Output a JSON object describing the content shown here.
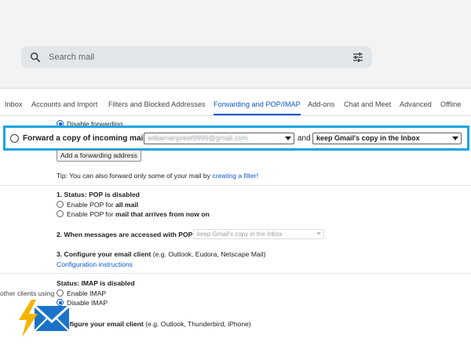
{
  "search": {
    "placeholder": "Search mail"
  },
  "tabs": [
    {
      "label": "Inbox",
      "active": false
    },
    {
      "label": "Accounts and Import",
      "active": false
    },
    {
      "label": "Filters and Blocked Addresses",
      "active": false
    },
    {
      "label": "Forwarding and POP/IMAP",
      "active": true
    },
    {
      "label": "Add-ons",
      "active": false
    },
    {
      "label": "Chat and Meet",
      "active": false
    },
    {
      "label": "Advanced",
      "active": false
    },
    {
      "label": "Offline",
      "active": false
    }
  ],
  "forwarding": {
    "disable_label": "Disable forwarding",
    "forward_label": "Forward a copy of incoming mail to",
    "email_value": "williamanpreet9999@gmail.com",
    "and_label": "and",
    "action_value": "keep Gmail's copy in the Inbox",
    "add_button": "Add a forwarding address",
    "tip_prefix": "Tip: You can also forward only some of your mail by",
    "tip_link": "creating a filter!"
  },
  "pop": {
    "status_heading": "1. Status: POP is disabled",
    "enable_all_prefix": "Enable POP for",
    "enable_all_bold": "all mail",
    "enable_now_prefix": "Enable POP for",
    "enable_now_bold": "mail that arrives from now on",
    "accessed_heading": "2. When messages are accessed with POP",
    "accessed_value": "keep Gmail's copy in the Inbox",
    "configure_heading": "3. Configure your email client",
    "configure_hint": "(e.g. Outlook, Eudora, Netscape Mail)",
    "configure_link": "Configuration instructions"
  },
  "imap": {
    "side_label": "other clients using",
    "status_heading": "Status: IMAP is disabled",
    "enable_label": "Enable IMAP",
    "disable_label": "Disable IMAP",
    "configure_heading": "Configure your email client",
    "configure_hint": "(e.g. Outlook, Thunderbird, iPhone)"
  },
  "colors": {
    "accent": "#0b57d0",
    "highlight_border": "#18a5e1",
    "logo_blue": "#1a73c8",
    "logo_bolt": "#f4b400"
  },
  "icons": {
    "search": "search-icon",
    "tune": "tune-icon",
    "logo": "mail-bolt-logo-icon"
  }
}
